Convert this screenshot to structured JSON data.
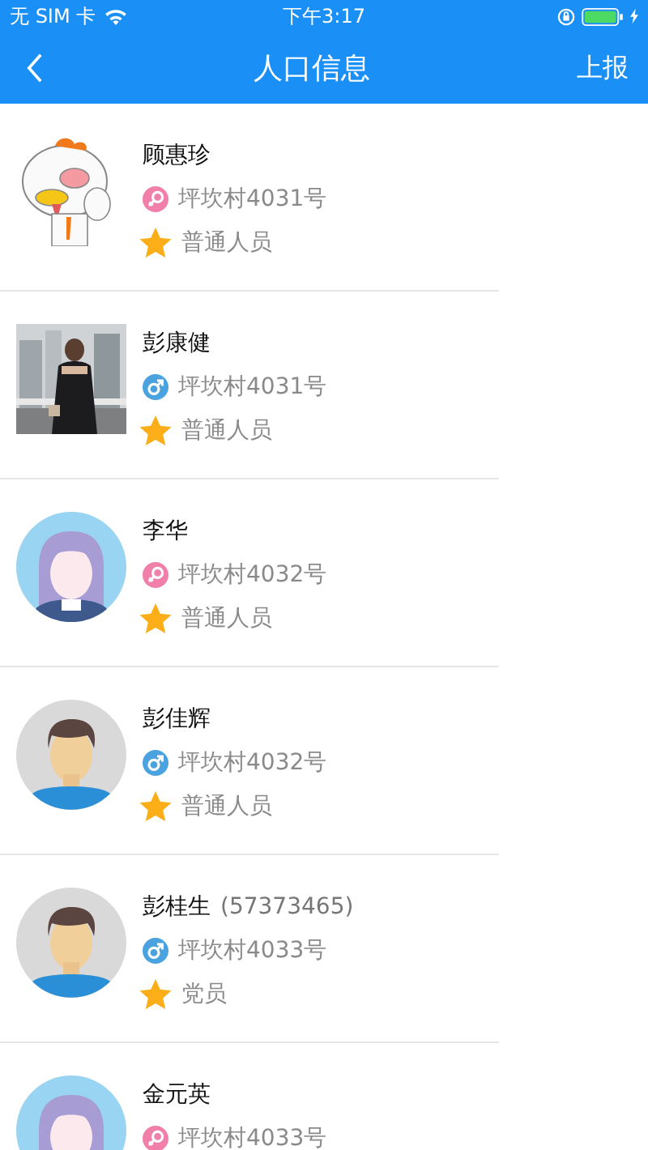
{
  "status_bar": {
    "carrier": "无 SIM 卡",
    "time": "下午3:17"
  },
  "nav_bar": {
    "title": "人口信息",
    "action": "上报"
  },
  "people": [
    {
      "name": "顾惠珍",
      "gender_icon": {
        "kind": "female"
      },
      "address": "坪坎村4031号",
      "tag": "普通人员"
    },
    {
      "name": "彭康健",
      "gender_icon": {
        "kind": "male"
      },
      "address": "坪坎村4031号",
      "tag": "普通人员"
    },
    {
      "name": "李华",
      "gender_icon": {
        "kind": "female"
      },
      "address": "坪坎村4032号",
      "tag": "普通人员",
      "avatar": {
        "kind": "female"
      }
    },
    {
      "name": "彭佳辉",
      "gender_icon": {
        "kind": "male"
      },
      "address": "坪坎村4032号",
      "tag": "普通人员",
      "avatar": {
        "kind": "male"
      }
    },
    {
      "name": "彭桂生",
      "number": "(57373465)",
      "gender_icon": {
        "kind": "male"
      },
      "address": "坪坎村4033号",
      "tag": "党员",
      "avatar": {
        "kind": "male"
      }
    },
    {
      "name": "金元英",
      "gender_icon": {
        "kind": "female"
      },
      "address": "坪坎村4033号",
      "avatar": {
        "kind": "female"
      }
    }
  ]
}
